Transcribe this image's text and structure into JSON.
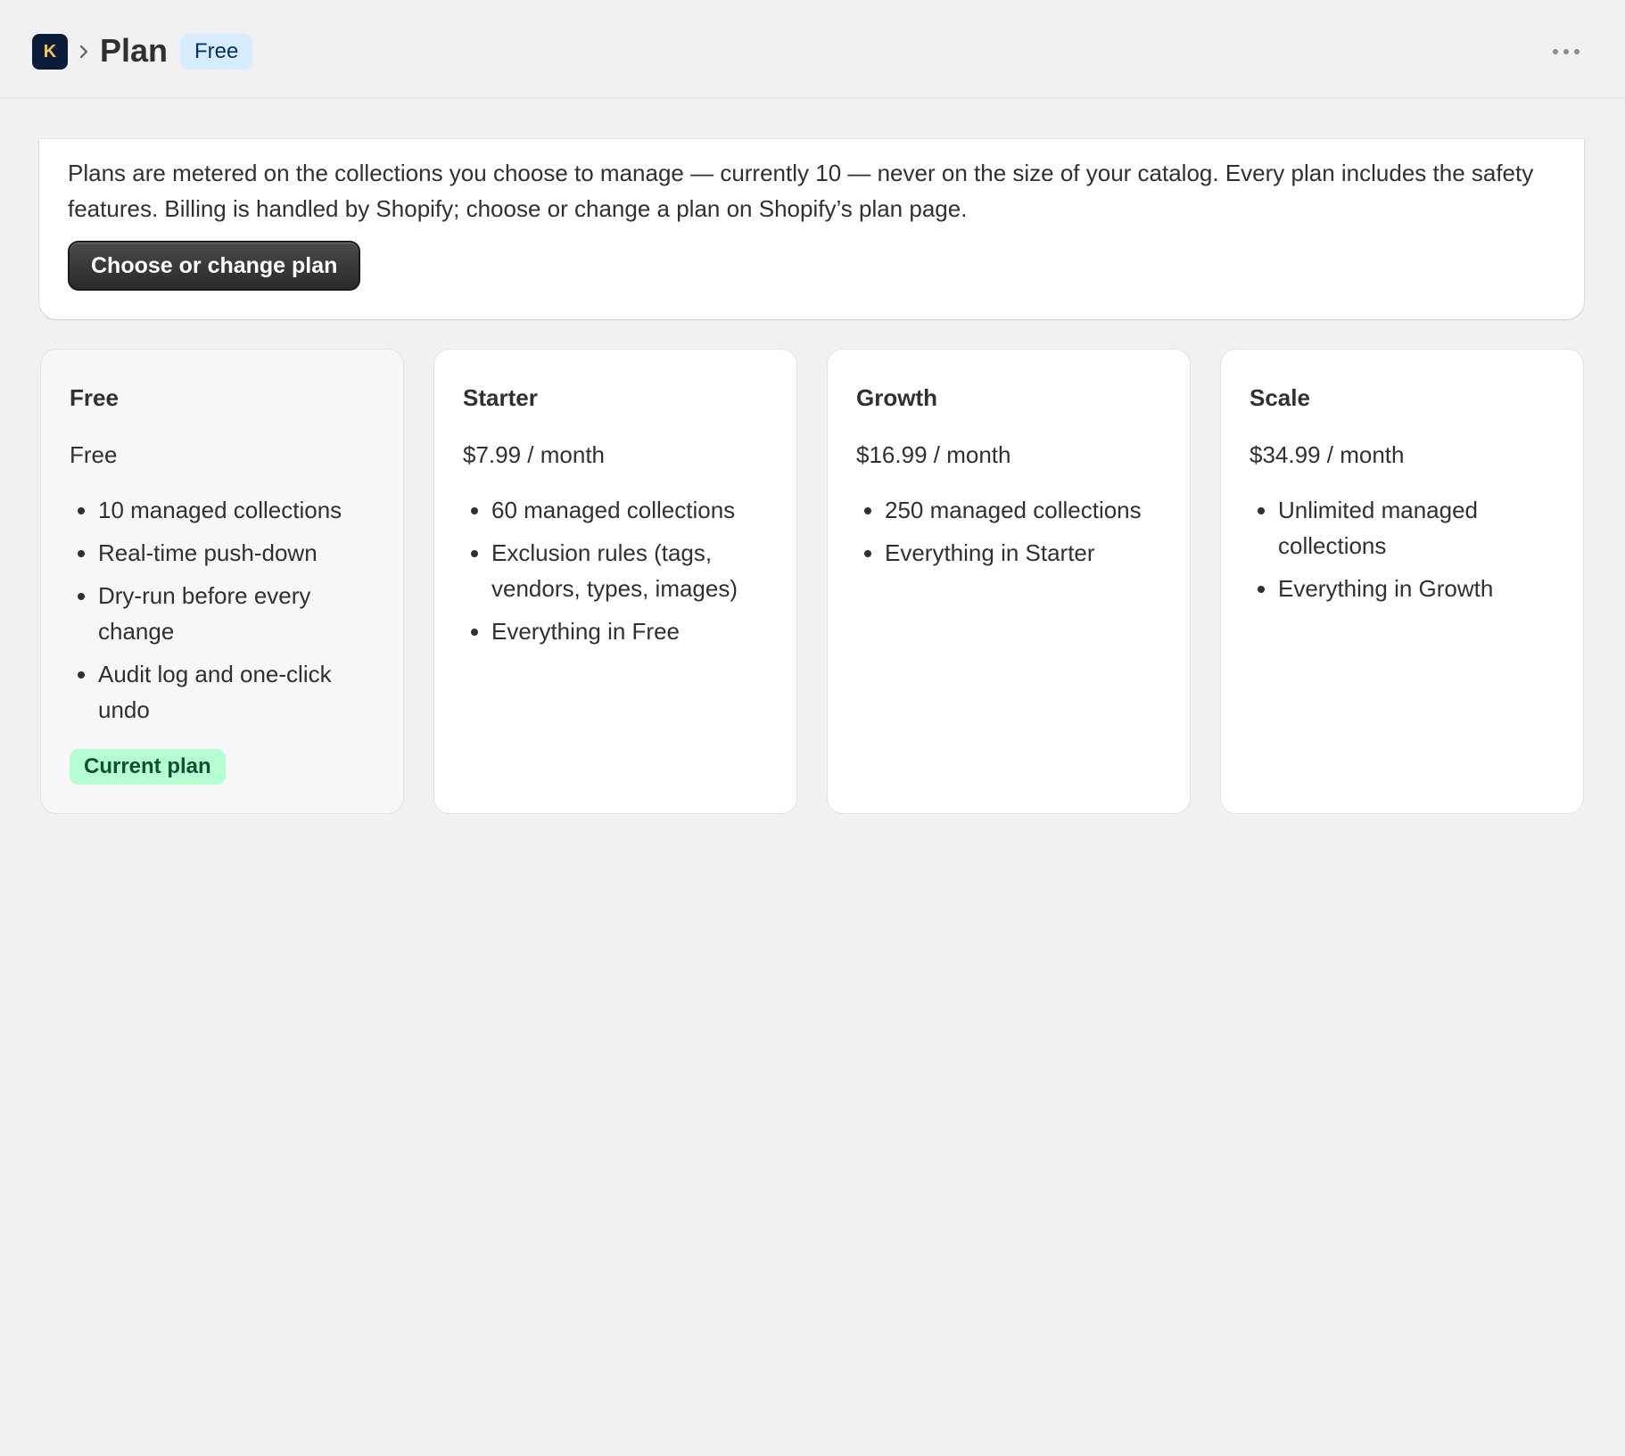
{
  "header": {
    "app_icon_letter": "K",
    "title": "Plan",
    "plan_badge": "Free"
  },
  "info": {
    "text": "Plans are metered on the collections you choose to manage — currently 10 — never on the size of your catalog. Every plan includes the safety features. Billing is handled by Shopify; choose or change a plan on Shopify’s plan page.",
    "button_label": "Choose or change plan"
  },
  "plans": [
    {
      "name": "Free",
      "price": "Free",
      "features": [
        "10 managed collections",
        "Real-time push-down",
        "Dry-run before every change",
        "Audit log and one-click undo"
      ],
      "badge": "Current plan"
    },
    {
      "name": "Starter",
      "price": "$7.99 / month",
      "features": [
        "60 managed collections",
        "Exclusion rules (tags, vendors, types, images)",
        "Everything in Free"
      ]
    },
    {
      "name": "Growth",
      "price": "$16.99 / month",
      "features": [
        "250 managed collections",
        "Everything in Starter"
      ]
    },
    {
      "name": "Scale",
      "price": "$34.99 / month",
      "features": [
        "Unlimited managed collections",
        "Everything in Growth"
      ]
    }
  ],
  "colors": {
    "page_background": "#f1f1f1",
    "app_icon_background": "#0d1b3a",
    "plan_badge_background": "#d8ecff",
    "current_badge_background": "#b4fed2",
    "primary_button": "#303030"
  },
  "icons": {
    "app": "app-logo-icon",
    "breadcrumb": "chevron-right-icon",
    "menu": "ellipsis-horizontal-icon"
  }
}
